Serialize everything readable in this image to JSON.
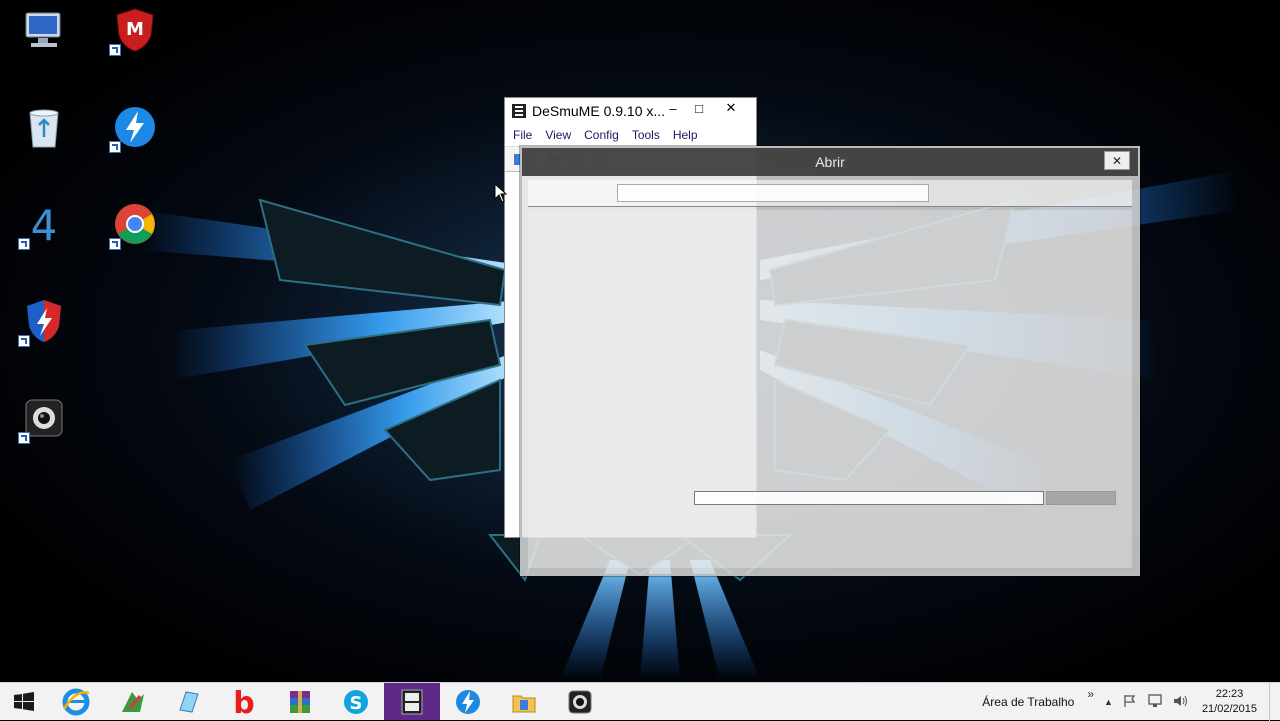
{
  "desktop": {
    "icons": [
      {
        "name": "computer-icon"
      },
      {
        "name": "mcafee-icon"
      },
      {
        "name": "recycle-bin-icon"
      },
      {
        "name": "lightning-app-icon"
      },
      {
        "name": "four-app-icon"
      },
      {
        "name": "chrome-icon"
      },
      {
        "name": "shield-app-icon"
      },
      {
        "name": "webcam-app-icon"
      }
    ]
  },
  "desmume": {
    "title": "DeSmuME 0.9.10 x...",
    "minimize": "–",
    "maximize": "□",
    "close": "✕",
    "menu": [
      "File",
      "View",
      "Config",
      "Tools",
      "Help"
    ]
  },
  "abrir": {
    "title": "Abrir",
    "close": "✕"
  },
  "taskbar": {
    "apps": [
      {
        "name": "start-icon"
      },
      {
        "name": "internet-explorer-icon"
      },
      {
        "name": "paint-app-icon"
      },
      {
        "name": "notepad-app-icon"
      },
      {
        "name": "bing-app-icon"
      },
      {
        "name": "winrar-icon"
      },
      {
        "name": "skype-icon"
      },
      {
        "name": "desmume-icon",
        "active": true
      },
      {
        "name": "lightning-app-icon"
      },
      {
        "name": "file-explorer-icon"
      },
      {
        "name": "webcam-app-icon"
      }
    ],
    "tray": {
      "area_label": "Área de Trabalho",
      "chevron": "»",
      "up_arrow": "▲",
      "time": "22:23",
      "date": "21/02/2015"
    }
  }
}
